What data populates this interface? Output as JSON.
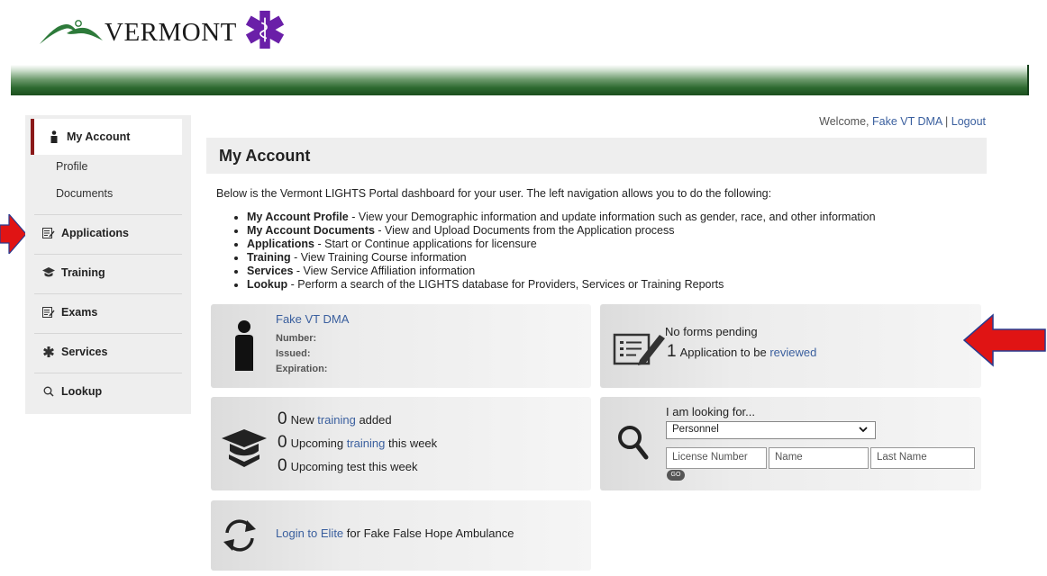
{
  "brand": {
    "wordmark": "VERMONT",
    "accent_green": "#2d6a30",
    "star_color": "#6a1fa8"
  },
  "sidebar": {
    "active": {
      "label": "My Account",
      "icon": "person-icon"
    },
    "sub_items": [
      "Profile",
      "Documents"
    ],
    "items": [
      {
        "label": "Applications",
        "icon": "form-icon"
      },
      {
        "label": "Training",
        "icon": "graduation-cap-icon"
      },
      {
        "label": "Exams",
        "icon": "form-icon"
      },
      {
        "label": "Services",
        "icon": "star-of-life-icon"
      },
      {
        "label": "Lookup",
        "icon": "search-icon"
      }
    ]
  },
  "header": {
    "welcome_prefix": "Welcome, ",
    "user": "Fake VT DMA",
    "separator": " | ",
    "logout": "Logout"
  },
  "main": {
    "title": "My Account",
    "intro": "Below is the Vermont LIGHTS Portal dashboard for your user. The left navigation allows you to do the following:",
    "features": [
      {
        "term": "My Account Profile",
        "desc": " - View your Demographic information and update information such as gender, race, and other information"
      },
      {
        "term": "My Account Documents",
        "desc": " - View and Upload Documents from the Application process"
      },
      {
        "term": "Applications",
        "desc": " - Start or Continue applications for licensure"
      },
      {
        "term": "Training",
        "desc": " - View Training Course information"
      },
      {
        "term": "Services",
        "desc": " - View Service Affiliation information"
      },
      {
        "term": "Lookup",
        "desc": " - Perform a search of the LIGHTS database for Providers, Services or Training Reports"
      }
    ]
  },
  "user_card": {
    "name": "Fake VT DMA",
    "number_label": "Number:",
    "issued_label": "Issued:",
    "expiration_label": "Expiration:"
  },
  "forms_card": {
    "pending": "No forms pending",
    "count": "1",
    "text": "Application to be ",
    "link": "reviewed"
  },
  "training_card": {
    "lines": [
      {
        "count": "0",
        "pre": "New ",
        "link": "training",
        "post": " added"
      },
      {
        "count": "0",
        "pre": "Upcoming ",
        "link": "training",
        "post": " this week"
      },
      {
        "count": "0",
        "pre": "Upcoming test this week",
        "link": "",
        "post": ""
      }
    ]
  },
  "search_card": {
    "heading": "I am looking for...",
    "select_value": "Personnel",
    "license_placeholder": "License Number",
    "name_placeholder": "Name",
    "last_name_placeholder": "Last Name",
    "go_label": "GO"
  },
  "elite_card": {
    "link": "Login to Elite",
    "text": " for Fake False Hope Ambulance"
  }
}
